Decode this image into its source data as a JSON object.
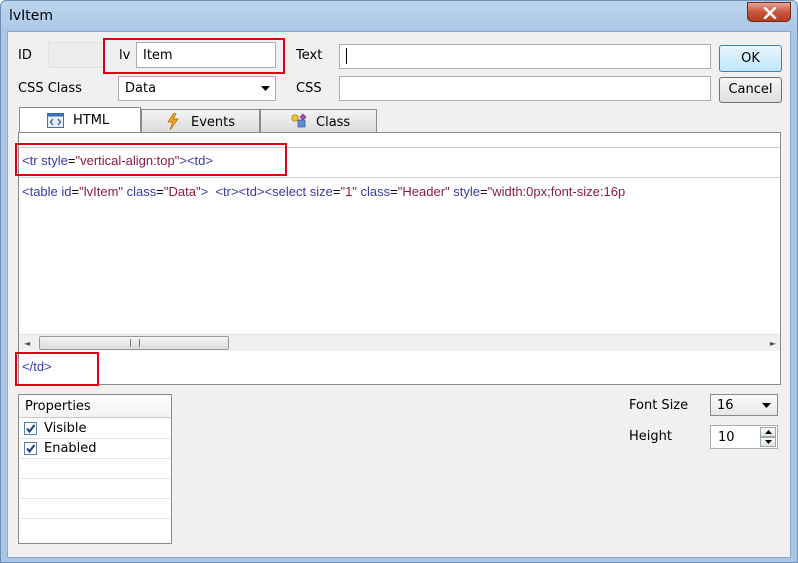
{
  "window": {
    "title": "lvItem"
  },
  "form": {
    "id_label": "ID",
    "id_prefix": "lv",
    "id_value": "Item",
    "text_label": "Text",
    "text_value": "",
    "css_class_label": "CSS Class",
    "css_class_value": "Data",
    "css_label": "CSS",
    "css_value": ""
  },
  "buttons": {
    "ok": "OK",
    "cancel": "Cancel"
  },
  "tabs": [
    {
      "label": "HTML",
      "icon": "html-code-icon",
      "active": true
    },
    {
      "label": "Events",
      "icon": "lightning-icon",
      "active": false
    },
    {
      "label": "Class",
      "icon": "class-icon",
      "active": false
    }
  ],
  "html_editor": {
    "prefix_html": "<tr style=\"vertical-align:top\"><td>",
    "content_line": "<table id=\"lvItem\" class=\"Data\">  <tr><td><select size=\"1\" class=\"Header\" style=\"width:0px;font-size:16p",
    "suffix_html": "</td>"
  },
  "properties": {
    "header": "Properties",
    "items": [
      {
        "label": "Visible",
        "checked": true
      },
      {
        "label": "Enabled",
        "checked": true
      }
    ]
  },
  "font_size": {
    "label": "Font Size",
    "value": "16"
  },
  "height": {
    "label": "Height",
    "value": "10"
  },
  "colors": {
    "accent": "#3a3aa8",
    "highlight": "#e00010",
    "value_color": "#8b1a4a"
  }
}
